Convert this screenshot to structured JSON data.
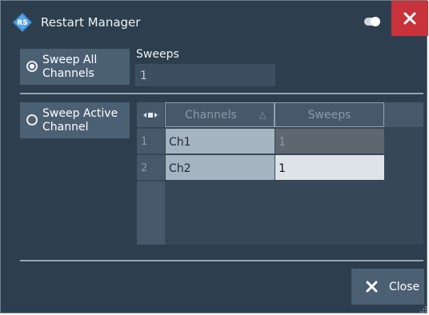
{
  "window": {
    "title": "Restart Manager",
    "colors": {
      "background": "#2d3e4e",
      "close": "#c8323a",
      "button": "#4c6073"
    }
  },
  "options": {
    "sweep_all_line1": "Sweep All",
    "sweep_all_line2": "Channels",
    "sweep_active_line1": "Sweep Active",
    "sweep_active_line2": "Channel",
    "selected": "sweep_all"
  },
  "sweeps": {
    "label": "Sweeps",
    "value": "1"
  },
  "table": {
    "corner_icon": "column-resize-icon",
    "headers": {
      "channels": "Channels",
      "sort_glyph": "△",
      "sweeps": "Sweeps"
    },
    "rows": [
      {
        "num": "1",
        "channel": "Ch1",
        "sweeps": "1"
      },
      {
        "num": "2",
        "channel": "Ch2",
        "sweeps": "1"
      }
    ]
  },
  "footer": {
    "close_label": "Close"
  }
}
